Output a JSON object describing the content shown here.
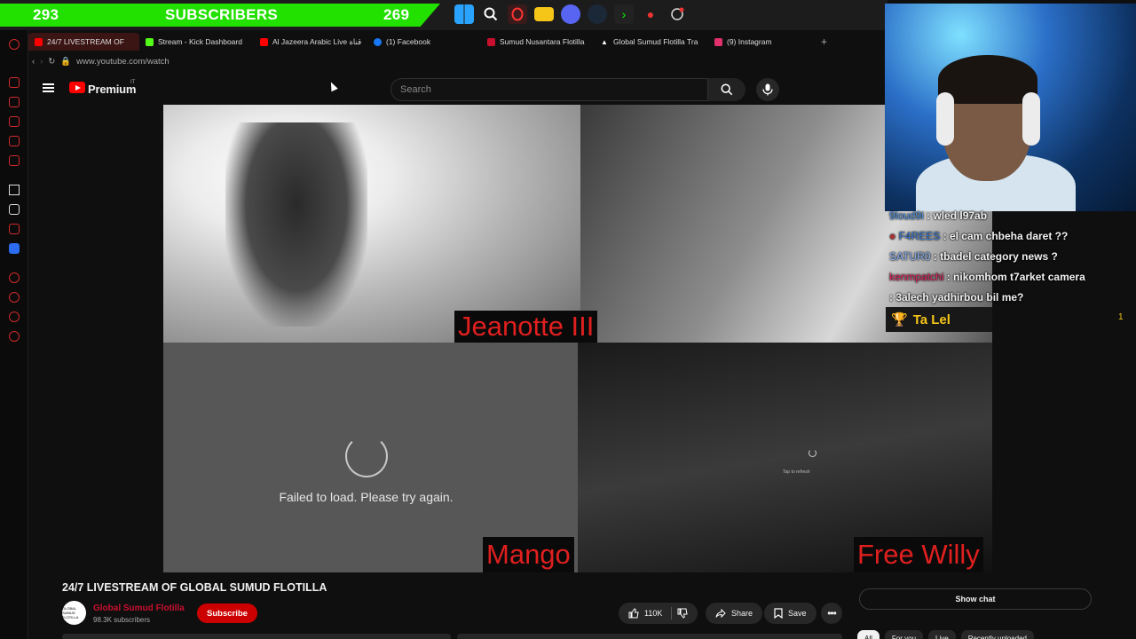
{
  "overlay": {
    "sub_count_left": "293",
    "sub_label": "SUBSCRIBERS",
    "sub_count_right": "269"
  },
  "taskbar": {
    "icons": [
      "windows-icon",
      "search-icon",
      "opera-icon",
      "folder-icon",
      "discord-icon",
      "steam-icon",
      "terminal-icon",
      "maps-icon",
      "clock-icon"
    ]
  },
  "browser": {
    "tabs": [
      {
        "label": "24/7 LIVESTREAM OF",
        "color": "#ff0000",
        "active": true
      },
      {
        "label": "Stream - Kick Dashboard",
        "color": "#53fc18"
      },
      {
        "label": "Al Jazeera Arabic Live قناة",
        "color": "#ff0000"
      },
      {
        "label": "(1) Facebook",
        "color": "#1877f2"
      },
      {
        "label": "Sumud Nusantara Flotilla",
        "color": "#c8102e"
      },
      {
        "label": "Global Sumud Flotilla Tra",
        "color": "#ffffff"
      },
      {
        "label": "(9) Instagram",
        "color": "#e1306c"
      }
    ],
    "url": "www.youtube.com/watch"
  },
  "youtube": {
    "logo_text": "Premium",
    "country": "IT",
    "search_placeholder": "Search",
    "video_title": "24/7 LIVESTREAM OF GLOBAL SUMUD FLOTILLA",
    "channel_name": "Global Sumud Flotilla",
    "channel_avatar_text": "GLOBAL SUMUD FLOTILLA",
    "subscribers": "98.3K subscribers",
    "subscribe_label": "Subscribe",
    "likes": "110K",
    "share_label": "Share",
    "save_label": "Save",
    "show_chat_label": "Show chat",
    "chips": [
      "All",
      "For you",
      "Live",
      "Recently uploaded"
    ]
  },
  "player": {
    "cam_labels": [
      "Jeanotte III",
      "Mango",
      "Free Willy"
    ],
    "failed_message": "Failed to load. Please try again.",
    "tap_refresh": "Tap to refresh"
  },
  "stream_chat": {
    "messages": [
      {
        "user": "9loud9i",
        "text": " : wled l97ab",
        "color": "#4a90e2"
      },
      {
        "user": "F4REES",
        "text": " : el cam chbeha daret ??",
        "color": "#3a7bd5"
      },
      {
        "user": "SATUR0",
        "text": " : tbadel category news ?",
        "color": "#8ab4f8"
      },
      {
        "user": "kenmpatchi",
        "text": " : nikomhom t7arket camera",
        "color": "#e0245e"
      },
      {
        "user": "",
        "text": ": 3alech yadhirbou bil me?",
        "color": "#ffffff"
      }
    ],
    "pinned_user": "Ta Lel",
    "pinned_count": "1"
  }
}
